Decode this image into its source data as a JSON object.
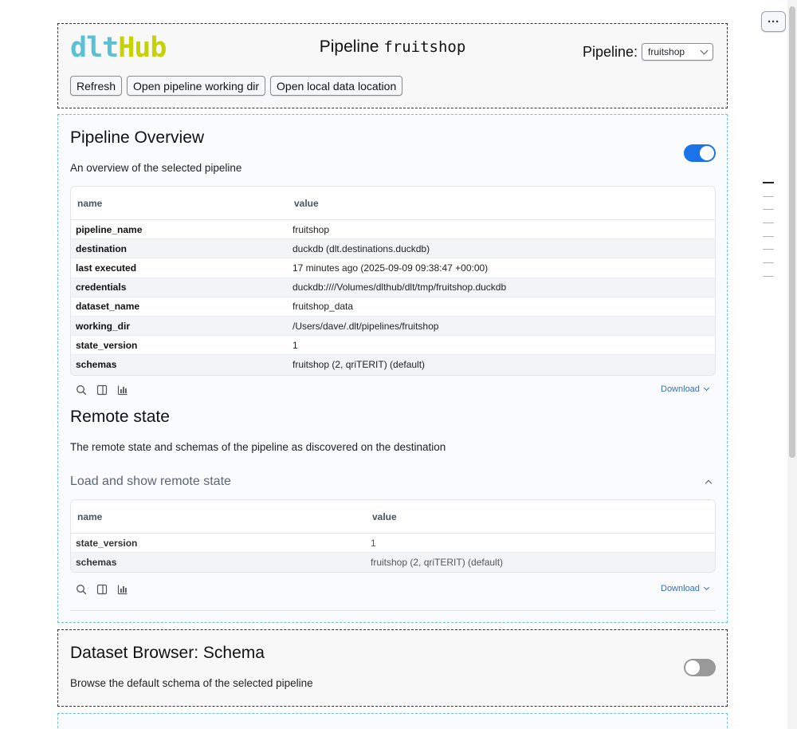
{
  "header": {
    "logo_dlt": "dlt",
    "logo_hub": "Hub",
    "title_prefix": "Pipeline",
    "title_name": "fruitshop",
    "pipeline_label": "Pipeline:",
    "pipeline_selected": "fruitshop",
    "buttons": [
      "Refresh",
      "Open pipeline working dir",
      "Open local data location"
    ]
  },
  "overview": {
    "title": "Pipeline Overview",
    "description": "An overview of the selected pipeline",
    "toggle_on": true,
    "columns": [
      "name",
      "value"
    ],
    "rows": [
      {
        "name": "pipeline_name",
        "value": "fruitshop"
      },
      {
        "name": "destination",
        "value": "duckdb (dlt.destinations.duckdb)"
      },
      {
        "name": "last executed",
        "value": "17 minutes ago (2025-09-09 09:38:47 +00:00)"
      },
      {
        "name": "credentials",
        "value": "duckdb:////Volumes/dlthub/dlt/tmp/fruitshop.duckdb"
      },
      {
        "name": "dataset_name",
        "value": "fruitshop_data"
      },
      {
        "name": "working_dir",
        "value": "/Users/dave/.dlt/pipelines/fruitshop"
      },
      {
        "name": "state_version",
        "value": "1"
      },
      {
        "name": "schemas",
        "value": "fruitshop (2, qriTERIT) (default)"
      }
    ],
    "download_label": "Download"
  },
  "remote": {
    "title": "Remote state",
    "description": "The remote state and schemas of the pipeline as discovered on the destination",
    "collapse_title": "Load and show remote state",
    "columns": [
      "name",
      "value"
    ],
    "rows": [
      {
        "name": "state_version",
        "value": "1"
      },
      {
        "name": "schemas",
        "value": "fruitshop (2, qriTERIT) (default)"
      }
    ],
    "download_label": "Download"
  },
  "schema_browser": {
    "title": "Dataset Browser: Schema",
    "description": "Browse the default schema of the selected pipeline",
    "toggle_on": false
  },
  "menu": {
    "label": "···"
  },
  "colors": {
    "toggle_on": "#1a73e8",
    "link": "#3b6fb6",
    "cell_border_active": "#6ec1e4"
  }
}
